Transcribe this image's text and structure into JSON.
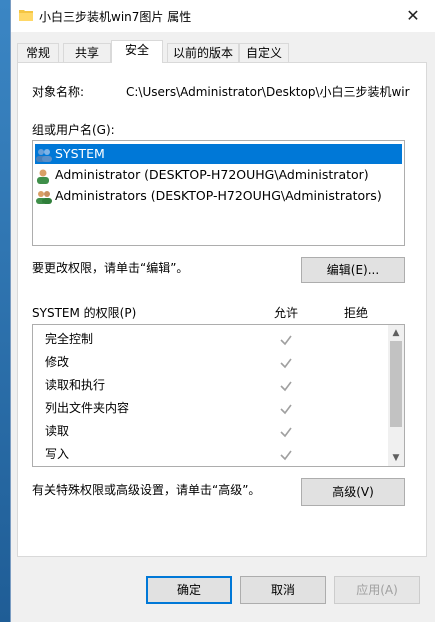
{
  "window": {
    "title": "小白三步装机win7图片 属性",
    "close_glyph": "✕"
  },
  "tabs": [
    {
      "label": "常规",
      "active": false
    },
    {
      "label": "共享",
      "active": false
    },
    {
      "label": "安全",
      "active": true
    },
    {
      "label": "以前的版本",
      "active": false
    },
    {
      "label": "自定义",
      "active": false
    }
  ],
  "security": {
    "object_name_label": "对象名称:",
    "object_name_value": "C:\\Users\\Administrator\\Desktop\\小白三步装机wir",
    "group_label": "组或用户名(G):",
    "users": [
      {
        "name": "SYSTEM",
        "icon": "users-group-icon",
        "selected": true
      },
      {
        "name": "Administrator (DESKTOP-H72OUHG\\Administrator)",
        "icon": "user-icon",
        "selected": false
      },
      {
        "name": "Administrators (DESKTOP-H72OUHG\\Administrators)",
        "icon": "users-group-icon",
        "selected": false
      }
    ],
    "edit_hint": "要更改权限，请单击“编辑”。",
    "edit_button": "编辑(E)...",
    "perm_header": "SYSTEM 的权限(P)",
    "allow_header": "允许",
    "deny_header": "拒绝",
    "permissions": [
      {
        "name": "完全控制",
        "allow": true,
        "deny": false
      },
      {
        "name": "修改",
        "allow": true,
        "deny": false
      },
      {
        "name": "读取和执行",
        "allow": true,
        "deny": false
      },
      {
        "name": "列出文件夹内容",
        "allow": true,
        "deny": false
      },
      {
        "name": "读取",
        "allow": true,
        "deny": false
      },
      {
        "name": "写入",
        "allow": true,
        "deny": false
      }
    ],
    "advanced_hint": "有关特殊权限或高级设置，请单击“高级”。",
    "advanced_button": "高级(V)"
  },
  "footer": {
    "ok": "确定",
    "cancel": "取消",
    "apply": "应用(A)"
  },
  "colors": {
    "selection": "#0078d7",
    "check": "#a0a0a0"
  }
}
